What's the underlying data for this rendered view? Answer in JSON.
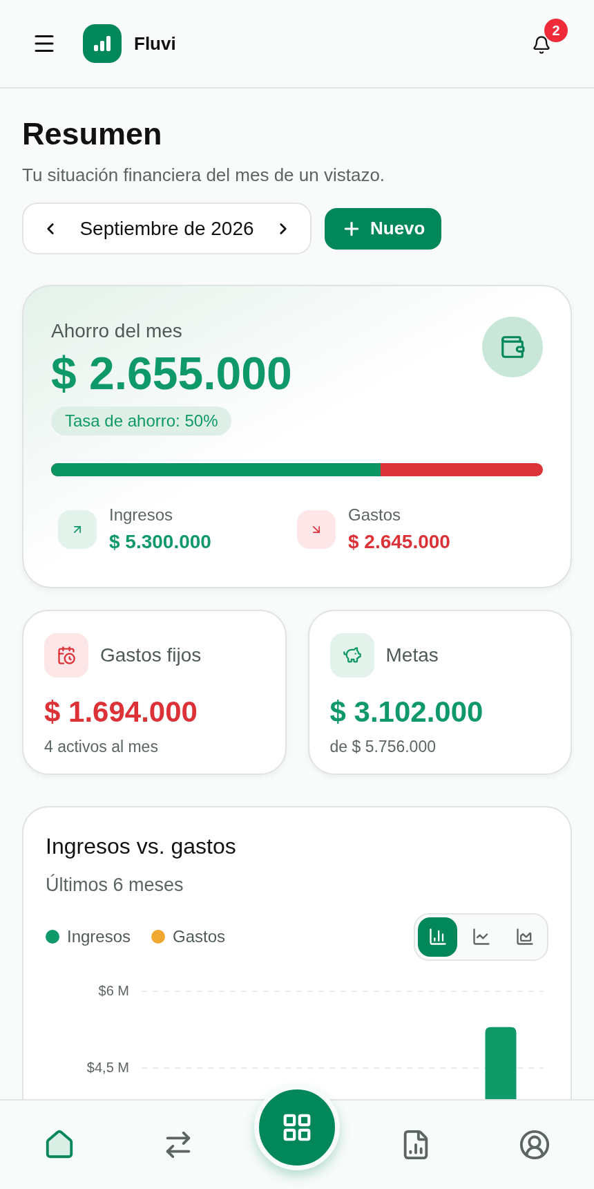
{
  "header": {
    "app_name": "Fluvi",
    "notifications": "2"
  },
  "page": {
    "title": "Resumen",
    "subtitle": "Tu situación financiera del mes de un vistazo.",
    "month": "Septiembre de 2026",
    "new_button": "Nuevo"
  },
  "savings": {
    "label": "Ahorro del mes",
    "amount": "$ 2.655.000",
    "rate": "Tasa de ahorro: 50%",
    "level": 0.67,
    "stats": [
      {
        "kind": "income",
        "label": "Ingresos",
        "value": "$ 5.300.000"
      },
      {
        "kind": "expense",
        "label": "Gastos",
        "value": "$ 2.645.000"
      }
    ]
  },
  "cards": [
    {
      "kind": "fixed",
      "title": "Gastos fijos",
      "amount": "$ 1.694.000",
      "note": "4 activos al mes"
    },
    {
      "kind": "goals",
      "title": "Metas",
      "amount": "$ 3.102.000",
      "note": "de $ 5.756.000"
    }
  ],
  "chart": {
    "title": "Ingresos vs. gastos",
    "subtitle": "Últimos 6 meses",
    "views": [
      {
        "kind": "bar",
        "selected": true
      },
      {
        "kind": "line",
        "selected": false
      },
      {
        "kind": "area",
        "selected": false
      }
    ],
    "chart_data": {
      "type": "bar",
      "ylim": [
        0,
        6000000
      ],
      "yticks": [
        {
          "value": 6000000,
          "label": "$6 M"
        },
        {
          "value": 4500000,
          "label": "$4,5 M"
        }
      ],
      "series": [
        {
          "name": "Ingresos",
          "color": "#0f9968",
          "values": [
            null,
            null,
            null,
            null,
            null,
            5300000
          ]
        },
        {
          "name": "Gastos",
          "color": "#f0a830",
          "values": [
            null,
            null,
            null,
            null,
            null,
            null
          ]
        }
      ]
    }
  },
  "nav": [
    {
      "kind": "tab",
      "selected": true
    },
    {
      "kind": "tab",
      "selected": false
    },
    {
      "kind": "action",
      "selected": false
    },
    {
      "kind": "tab",
      "selected": false
    },
    {
      "kind": "tab",
      "selected": false
    }
  ]
}
